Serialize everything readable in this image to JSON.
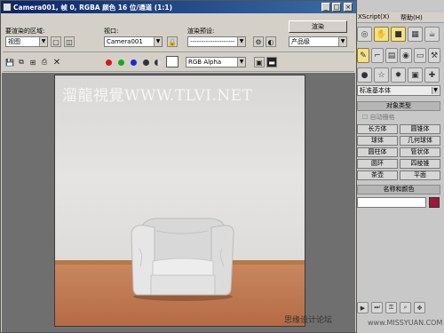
{
  "dialog": {
    "title": "Camera001, 帧 0, RGBA 颜色 16 位/通道 (1:1)",
    "area_label": "要渲染的区域:",
    "area_value": "视图",
    "viewport_label": "视口:",
    "viewport_value": "Camera001",
    "preset_label": "渲染预设:",
    "preset_value": "--------------------",
    "render_button": "渲染",
    "product_value": "产品级",
    "channel_value": "RGB Alpha",
    "watermark": "溜龍視覺WWW.TLVI.NET"
  },
  "cmd_panel": {
    "menu_items": [
      "XScript(X)",
      "帮助(H)"
    ],
    "dropdown": "标准基本体",
    "rollout_types": "对象类型",
    "autogrid": "自动栅格",
    "objects": [
      "长方体",
      "圆锥体",
      "球体",
      "几何球体",
      "圆柱体",
      "管状体",
      "圆环",
      "四棱锥",
      "茶壶",
      "平面"
    ],
    "rollout_name": "名称和颜色"
  },
  "colors": {
    "red_channel": "#d11a1a",
    "green_channel": "#1aa81a",
    "blue_channel": "#1a2ad1",
    "title_bar": "#0a246a",
    "object_color": "#a01638"
  },
  "footer": {
    "site_text": "思缘设计论坛",
    "site_url": "www.MISSYUAN.COM"
  }
}
